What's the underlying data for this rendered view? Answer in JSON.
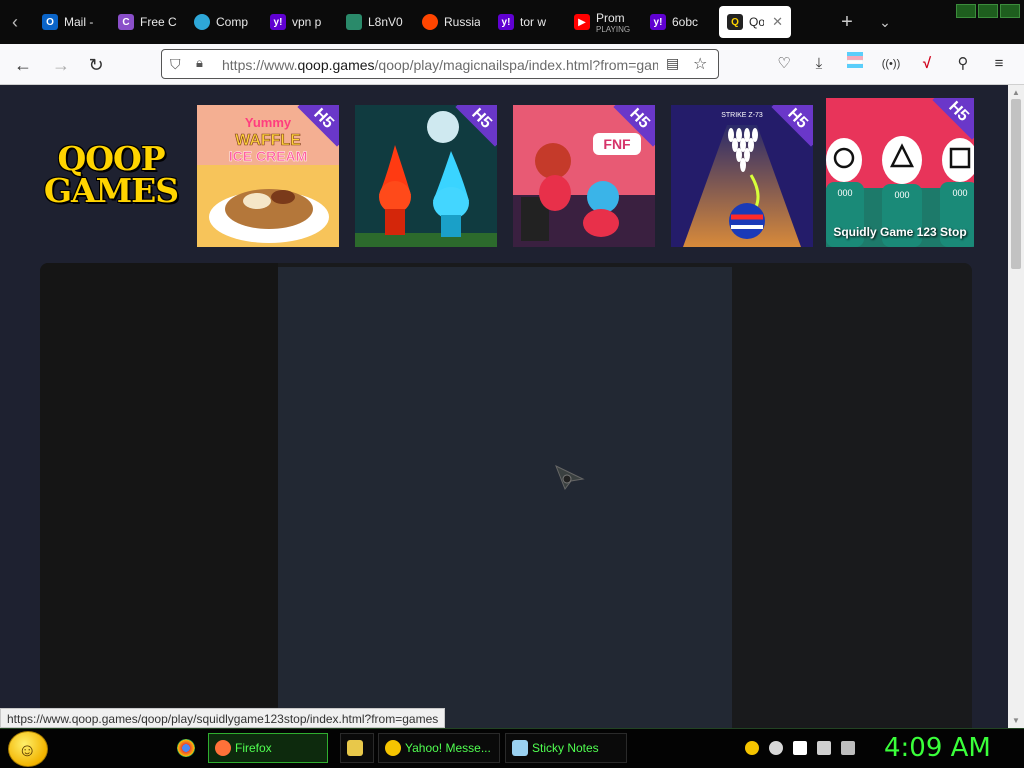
{
  "tabs": [
    {
      "label": "Mail -",
      "favicon_color": "#0a64c8",
      "glyph": "O"
    },
    {
      "label": "Free C",
      "favicon_color": "#8a4fc9",
      "glyph": "C"
    },
    {
      "label": "Comp",
      "favicon_color": "#2ea7d8",
      "glyph": ""
    },
    {
      "label": "vpn p",
      "favicon_color": "#6001d2",
      "glyph": "y"
    },
    {
      "label": "L8nV0",
      "favicon_color": "#2a8a6a",
      "glyph": ""
    },
    {
      "label": "Russia",
      "favicon_color": "#ff4500",
      "glyph": ""
    },
    {
      "label": "tor w",
      "favicon_color": "#6001d2",
      "glyph": "y"
    },
    {
      "label": "Prom",
      "sublabel": "PLAYING",
      "favicon_color": "#ff0000",
      "glyph": "▶"
    },
    {
      "label": "6obc",
      "favicon_color": "#6001d2",
      "glyph": "y"
    },
    {
      "label": "Qo",
      "favicon_color": "#222",
      "glyph": "Q",
      "active": true
    }
  ],
  "url": {
    "prefix": "https://www.",
    "domain": "qoop.games",
    "rest": "/qoop/play/magicnailspa/index.html?from=games"
  },
  "site": {
    "logo_line1": "QOOP",
    "logo_line2": "GAMES",
    "logo_color": "#ffd400"
  },
  "games": [
    {
      "badge": "H5",
      "caption": "",
      "art": "waffle",
      "bg": "#f5b53a"
    },
    {
      "badge": "H5",
      "caption": "",
      "art": "fireboy",
      "bg": "#1b5a4a"
    },
    {
      "badge": "H5",
      "caption": "",
      "art": "fnf",
      "bg": "#e05a70"
    },
    {
      "badge": "H5",
      "caption": "",
      "art": "bowling",
      "bg": "#3a2ea0"
    },
    {
      "badge": "H5",
      "caption": "Squidly Game 123 Stop",
      "art": "squid",
      "bg": "#e8345a"
    }
  ],
  "status_link": "https://www.qoop.games/qoop/play/squidlygame123stop/index.html?from=games",
  "taskbar": {
    "tasks": [
      {
        "label": "Firefox",
        "icon_color": "#ff7139",
        "active": true
      },
      {
        "label": "",
        "icon_color": "#e8c84a",
        "active": false
      },
      {
        "label": "Yahoo! Messe...",
        "icon_color": "#f5c400",
        "active": false
      },
      {
        "label": "Sticky Notes",
        "icon_color": "#9ad1f0",
        "active": false
      }
    ],
    "clock": "4:09 AM"
  },
  "colors": {
    "page_bg": "#1e2130",
    "badge_purple": "#6a37c9",
    "taskbar_text": "#50ff50",
    "clock": "#3aff3a"
  }
}
